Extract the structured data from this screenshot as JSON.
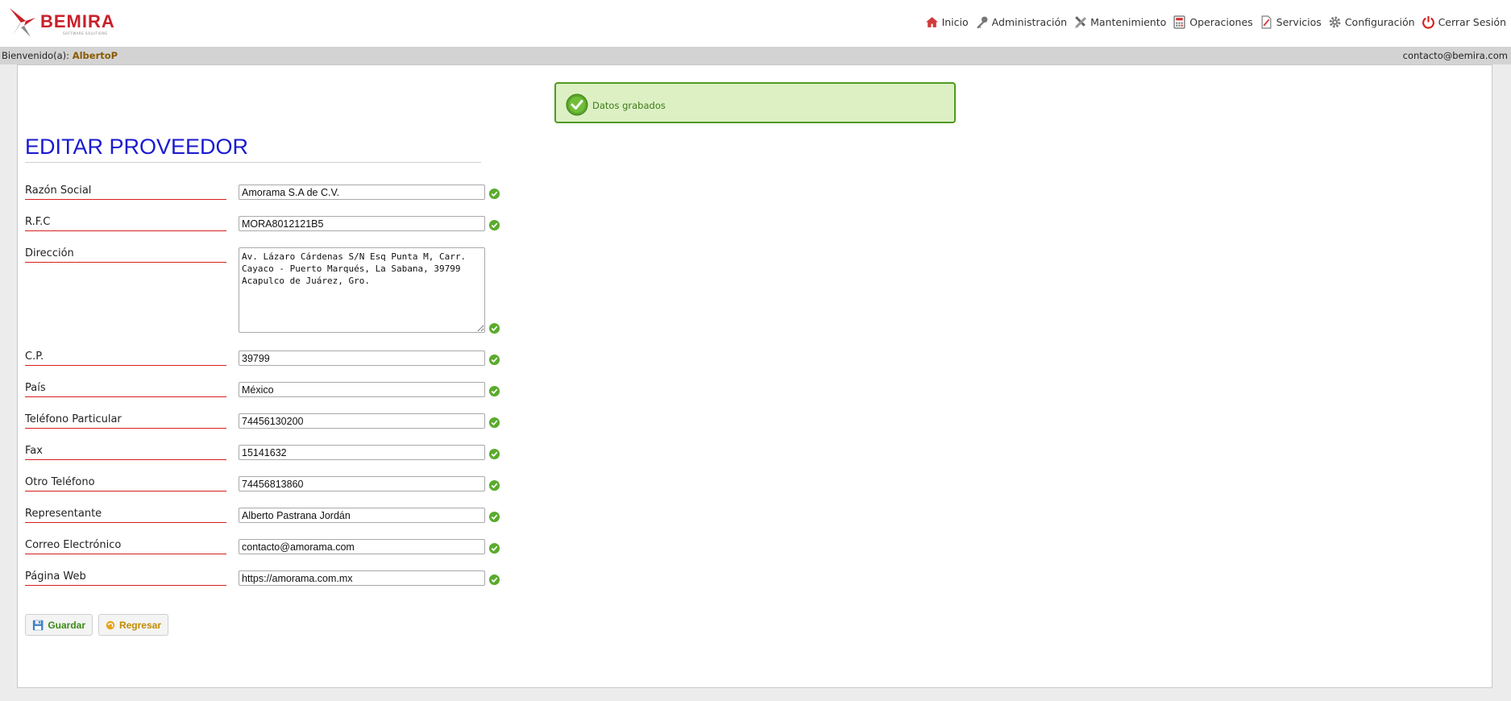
{
  "brand": {
    "name": "BEMIRA",
    "tagline": "SOFTWARE SOLUTIONS"
  },
  "nav": [
    {
      "label": "Inicio",
      "icon": "home-icon"
    },
    {
      "label": "Administración",
      "icon": "key-icon"
    },
    {
      "label": "Mantenimiento",
      "icon": "tools-icon"
    },
    {
      "label": "Operaciones",
      "icon": "calculator-icon"
    },
    {
      "label": "Servicios",
      "icon": "document-icon"
    },
    {
      "label": "Configuración",
      "icon": "gear-icon"
    },
    {
      "label": "Cerrar Sesión",
      "icon": "power-icon"
    }
  ],
  "welcome": {
    "prefix": "Bienvenido(a):",
    "user": "AlbertoP",
    "email": "contacto@bemira.com"
  },
  "alert": {
    "message": "Datos grabados"
  },
  "form": {
    "title": "EDITAR PROVEEDOR",
    "fields": [
      {
        "label": "Razón Social",
        "value": "Amorama S.A de C.V."
      },
      {
        "label": "R.F.C",
        "value": "MORA8012121B5"
      },
      {
        "label": "Dirección",
        "value": "Av. Lázaro Cárdenas S/N Esq Punta M, Carr. Cayaco - Puerto Marqués, La Sabana, 39799 Acapulco de Juárez, Gro."
      },
      {
        "label": "C.P.",
        "value": "39799"
      },
      {
        "label": "País",
        "value": "México"
      },
      {
        "label": "Teléfono Particular",
        "value": "74456130200"
      },
      {
        "label": "Fax",
        "value": "15141632"
      },
      {
        "label": "Otro Teléfono",
        "value": "74456813860"
      },
      {
        "label": "Representante",
        "value": "Alberto Pastrana Jordán"
      },
      {
        "label": "Correo Electrónico",
        "value": "contacto@amorama.com"
      },
      {
        "label": "Página Web",
        "value": "https://amorama.com.mx"
      }
    ],
    "save_label": "Guardar",
    "back_label": "Regresar"
  },
  "colors": {
    "accent": "#1a1ad0",
    "success": "#4f9a1f",
    "brand": "#c8202a",
    "underline": "#d81e1e"
  }
}
